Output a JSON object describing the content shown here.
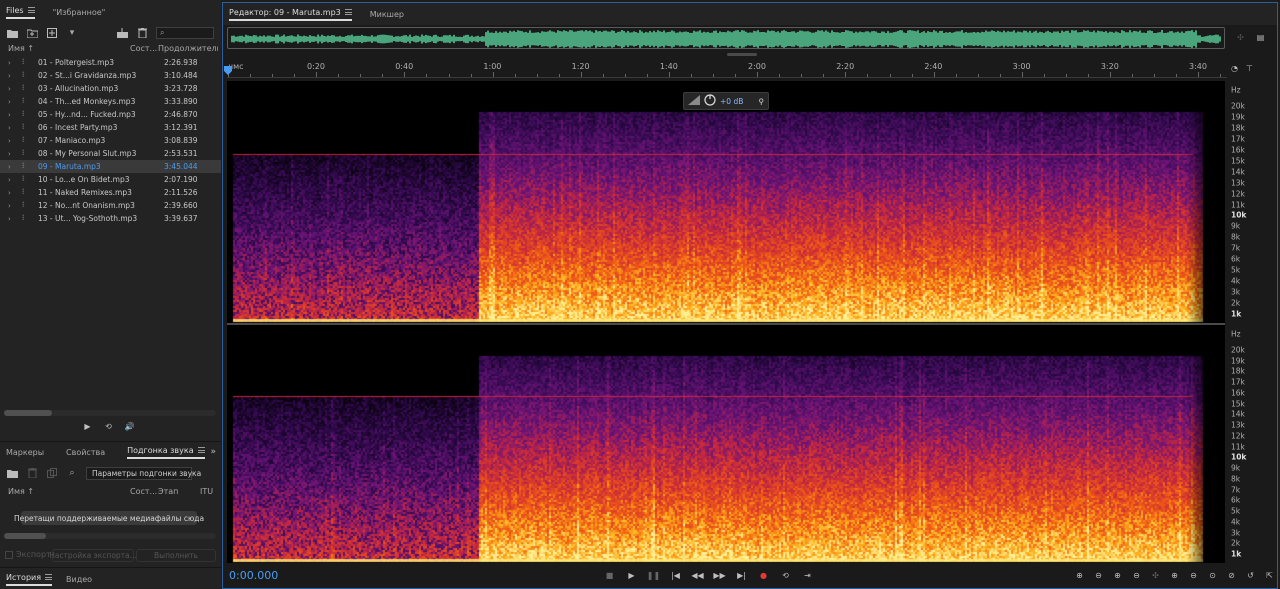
{
  "left_panel": {
    "tabs": [
      {
        "label": "Files",
        "active": true
      },
      {
        "label": "\"Избранное\"",
        "active": false
      }
    ],
    "search_placeholder": "",
    "columns": {
      "name": "Имя ↑",
      "state": "Сост...",
      "duration": "Продолжительн..."
    },
    "files": [
      {
        "name": "01 - Poltergeist.mp3",
        "duration": "2:26.938",
        "selected": false
      },
      {
        "name": "02 - St...i Gravidanza.mp3",
        "duration": "3:10.484",
        "selected": false
      },
      {
        "name": "03 - Allucination.mp3",
        "duration": "3:23.728",
        "selected": false
      },
      {
        "name": "04 - Th...ed Monkeys.mp3",
        "duration": "3:33.890",
        "selected": false
      },
      {
        "name": "05 - Hy...nd... Fucked.mp3",
        "duration": "2:46.870",
        "selected": false
      },
      {
        "name": "06 - Incest Party.mp3",
        "duration": "3:12.391",
        "selected": false
      },
      {
        "name": "07 - Maniaco.mp3",
        "duration": "3:08.839",
        "selected": false
      },
      {
        "name": "08 - My Personal Slut.mp3",
        "duration": "2:53.531",
        "selected": false
      },
      {
        "name": "09 - Maruta.mp3",
        "duration": "3:45.044",
        "selected": true
      },
      {
        "name": "10 - Lo...e On Bidet.mp3",
        "duration": "2:07.190",
        "selected": false
      },
      {
        "name": "11 - Naked Remixes.mp3",
        "duration": "2:11.526",
        "selected": false
      },
      {
        "name": "12 - No...nt Onanism.mp3",
        "duration": "2:39.660",
        "selected": false
      },
      {
        "name": "13 - Ut... Yog-Sothoth.mp3",
        "duration": "3:39.637",
        "selected": false
      }
    ],
    "lower_tabs": [
      {
        "label": "Маркеры",
        "active": false
      },
      {
        "label": "Свойства",
        "active": false
      },
      {
        "label": "Подгонка звука",
        "active": true
      }
    ],
    "match_params_label": "Параметры подгонки звука",
    "match_columns": {
      "name": "Имя ↑",
      "state": "Сост...",
      "stage": "Этап",
      "itu": "ITU"
    },
    "drop_hint": "Перетащи поддерживаемые медиафайлы сюда",
    "export_label": "Экспорт",
    "export_settings_label": "Настройка экспорта...",
    "run_label": "Выполнить",
    "bottom_tabs": [
      {
        "label": "История",
        "active": true
      },
      {
        "label": "Видео",
        "active": false
      }
    ]
  },
  "editor": {
    "tabs": [
      {
        "label": "Редактор: 09 - Maruta.mp3",
        "active": true
      },
      {
        "label": "Микшер",
        "active": false
      }
    ],
    "ruler_unit": "чмс",
    "time_ticks": [
      "0:20",
      "0:40",
      "1:00",
      "1:20",
      "1:40",
      "2:00",
      "2:20",
      "2:40",
      "3:00",
      "3:20",
      "3:40"
    ],
    "freq_unit": "Hz",
    "freq_labels": [
      "20k",
      "19k",
      "18k",
      "17k",
      "16k",
      "15k",
      "14k",
      "13k",
      "12k",
      "11k",
      "10k",
      "9k",
      "8k",
      "7k",
      "6k",
      "5k",
      "4k",
      "3k",
      "2k",
      "1k"
    ],
    "gain_readout": "+0 dB",
    "timecode": "0:00.000",
    "colors": {
      "accent": "#4a9cf0",
      "waveform": "#5fe0a8",
      "spectro_hot": "#ffcc33",
      "spectro_mid": "#d83a2a",
      "spectro_low": "#5a1a7a"
    }
  }
}
